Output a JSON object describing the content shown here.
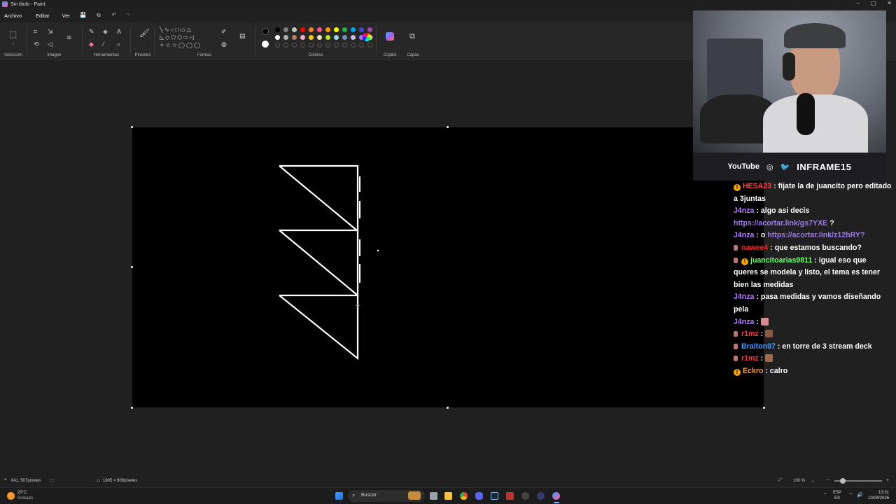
{
  "window": {
    "title": "Sin título - Paint"
  },
  "menu": {
    "archivo": "Archivo",
    "editar": "Editar",
    "ver": "Ver"
  },
  "ribbon": {
    "seleccion": "Selección",
    "imagen": "Imagen",
    "herramientas": "Herramientas",
    "pinceles": "Pinceles",
    "formas": "Formas",
    "colores": "Colores",
    "copilot": "Copilot",
    "capas": "Capas"
  },
  "palette": {
    "row1": [
      "#000000",
      "#7f7f7f",
      "#c3c3c3",
      "#ff0000",
      "#ff7f27",
      "#ff4f8c",
      "#ff9900",
      "#ffff00",
      "#22b14c",
      "#00a2e8",
      "#3f48cc",
      "#a349a4"
    ],
    "row2": [
      "#ffffff",
      "#b0b0b0",
      "#b97a57",
      "#ffaec9",
      "#ffc90e",
      "#efe4b0",
      "#b5e61d",
      "#99d9ea",
      "#7092be",
      "#c8bfe7",
      "#9f7aea",
      "#ffffff"
    ],
    "primary": "#000000",
    "secondary": "#ffffff"
  },
  "status": {
    "cursor_pos": "641, 507píxeles",
    "canvas_size": "1805 × 800píxeles",
    "zoom": "100 %"
  },
  "taskbar": {
    "weather_temp": "20°C",
    "weather_desc": "Soleado",
    "search_placeholder": "Buscar",
    "lang1": "ESP",
    "lang2": "ES",
    "time": "13:31",
    "date": "10/04/2026"
  },
  "stream": {
    "youtube": "YouTube",
    "brand": "INFRAME15"
  },
  "chat": [
    {
      "user": "HESA23",
      "color": "#ff4444",
      "badge": "gold",
      "text": "fijate la de juancito pero editado a 3juntas"
    },
    {
      "user": "J4nza",
      "color": "#b57cff",
      "badge": "",
      "text": "algo asi decis",
      "link": "https://acortar.link/gs7YXE",
      "after": "?"
    },
    {
      "user": "J4nza",
      "color": "#b57cff",
      "badge": "",
      "text": "o",
      "link": "https://acortar.link/z12hRY?",
      "after": ""
    },
    {
      "user": "nawee4",
      "color": "#ff2222",
      "badge": "sub",
      "text": "que estamos buscando?"
    },
    {
      "user": "juancitoarias9811",
      "color": "#66ff66",
      "badge": "subgold",
      "text": "igual eso que queres se modela y listo, el tema es tener bien las medidas"
    },
    {
      "user": "J4nza",
      "color": "#b57cff",
      "badge": "",
      "text": "pasa medidas y vamos diseñando pela"
    },
    {
      "user": "J4nza",
      "color": "#b57cff",
      "badge": "",
      "text": "",
      "emote": "#d98c8c"
    },
    {
      "user": "r1mz",
      "color": "#ff3333",
      "badge": "sub",
      "text": "",
      "emote": "#8a5a44"
    },
    {
      "user": "Braiton97",
      "color": "#4499ff",
      "badge": "sub",
      "text": "en torre de 3 stream deck"
    },
    {
      "user": "r1mz",
      "color": "#ff3333",
      "badge": "sub",
      "text": "",
      "emote": "#a06a4a"
    },
    {
      "user": "Eckro",
      "color": "#ff9933",
      "badge": "gold",
      "text": "calro"
    }
  ]
}
